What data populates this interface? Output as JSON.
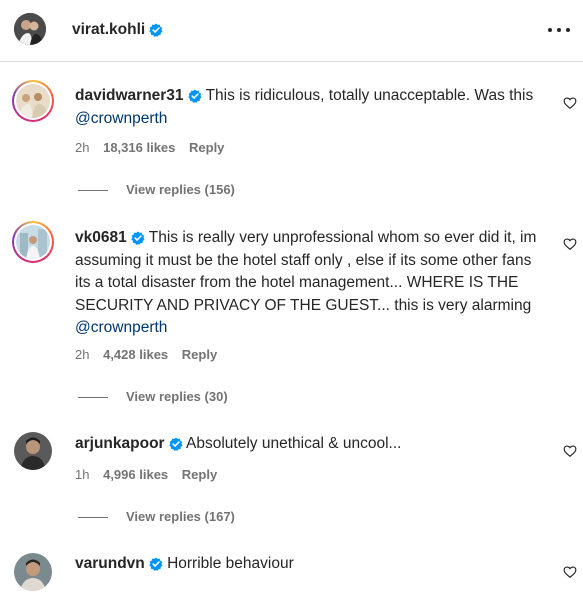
{
  "post_header": {
    "username": "virat.kohli",
    "avatar_icon": "avatar-couple-photo",
    "more_icon": "more-horizontal-icon"
  },
  "comments": [
    {
      "username": "davidwarner31",
      "verified": true,
      "text": "This is ridiculous, totally unacceptable. Was this ",
      "mention": "@crownperth",
      "time": "2h",
      "likes": "18,316 likes",
      "reply": "Reply",
      "view_replies": "View replies (156)"
    },
    {
      "username": "vk0681",
      "verified": true,
      "text": "This is really very unprofessional whom so ever did it, im assuming it must be the hotel staff only , else if its some other fans its a total disaster from the hotel management... WHERE IS THE SECURITY AND PRIVACY OF THE GUEST... this is very alarming ",
      "mention": "@crownperth",
      "time": "2h",
      "likes": "4,428 likes",
      "reply": "Reply",
      "view_replies": "View replies (30)"
    },
    {
      "username": "arjunkapoor",
      "verified": true,
      "text": "Absolutely unethical & uncool...",
      "mention": "",
      "time": "1h",
      "likes": "4,996 likes",
      "reply": "Reply",
      "view_replies": "View replies (167)"
    },
    {
      "username": "varundvn",
      "verified": true,
      "text": "Horrible behaviour",
      "mention": "",
      "time": "",
      "likes": "",
      "reply": "",
      "view_replies": ""
    }
  ],
  "colors": {
    "verified_blue": "#0095f6",
    "mention_blue": "#00376b",
    "secondary_text": "#737373",
    "primary_text": "#262626"
  }
}
